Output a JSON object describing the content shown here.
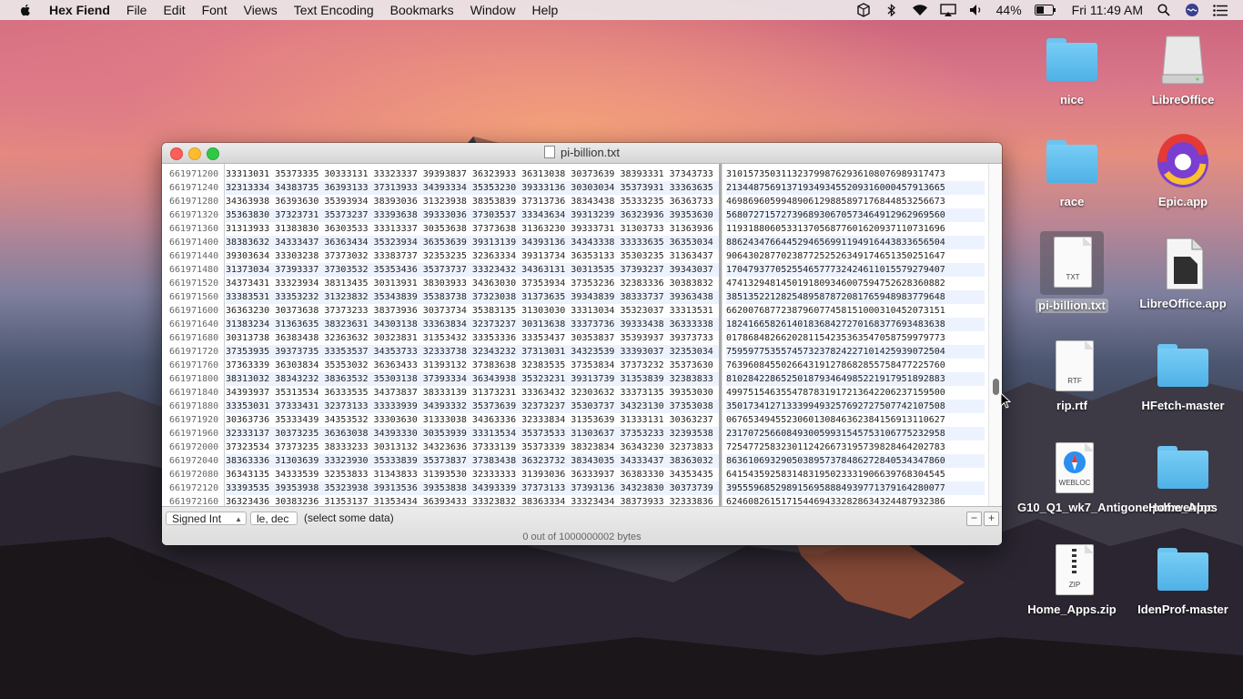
{
  "menubar": {
    "app_name": "Hex Fiend",
    "items": [
      "File",
      "Edit",
      "Font",
      "Views",
      "Text Encoding",
      "Bookmarks",
      "Window",
      "Help"
    ],
    "battery": "44%",
    "clock": "Fri 11:49 AM"
  },
  "window": {
    "title": "pi-billion.txt",
    "rows": [
      {
        "offset": "661971200",
        "hex": "33313031 35373335 30333131 33323337 39393837 36323933 36313038 30373639 38393331 37343733",
        "ascii": "3101573503113237998762936108076989317473"
      },
      {
        "offset": "661971240",
        "hex": "32313334 34383735 36393133 37313933 34393334 35353230 39333136 30303034 35373931 33363635",
        "ascii": "2134487569137193493455209316000457913665"
      },
      {
        "offset": "661971280",
        "hex": "34363938 36393630 35393934 38393036 31323938 38353839 37313736 38343438 35333235 36363733",
        "ascii": "4698696059948906129885897176844853256673"
      },
      {
        "offset": "661971320",
        "hex": "35363830 37323731 35373237 33393638 39333036 37303537 33343634 39313239 36323936 39353630",
        "ascii": "5680727157273968930670573464912962969560"
      },
      {
        "offset": "661971360",
        "hex": "31313933 31383830 36303533 33313337 30353638 37373638 31363230 39333731 31303733 31363936",
        "ascii": "1193188060533137056877601620937110731696"
      },
      {
        "offset": "661971400",
        "hex": "38383632 34333437 36363434 35323934 36353639 39313139 34393136 34343338 33333635 36353034",
        "ascii": "8862434766445294656991194916443833656504"
      },
      {
        "offset": "661971440",
        "hex": "39303634 33303238 37373032 33383737 32353235 32363334 39313734 36353133 35303235 31363437",
        "ascii": "9064302877023877252526349174651350251647"
      },
      {
        "offset": "661971480",
        "hex": "31373034 37393337 37303532 35353436 35373737 33323432 34363131 30313535 37393237 39343037",
        "ascii": "1704793770525546577732424611015579279407"
      },
      {
        "offset": "661971520",
        "hex": "34373431 33323934 38313435 30313931 38303933 34363030 37353934 37353236 32383336 30383832",
        "ascii": "4741329481450191809346007594752628360882"
      },
      {
        "offset": "661971560",
        "hex": "33383531 33353232 31323832 35343839 35383738 37323038 31373635 39343839 38333737 39363438",
        "ascii": "3851352212825489587872081765948983779648"
      },
      {
        "offset": "661971600",
        "hex": "36363230 30373638 37373233 38373936 30373734 35383135 31303030 33313034 35323037 33313531",
        "ascii": "6620076877238796077458151000310452073151"
      },
      {
        "offset": "661971640",
        "hex": "31383234 31363635 38323631 34303138 33363834 32373237 30313638 33373736 39333438 36333338",
        "ascii": "1824166582614018368427270168377693483638"
      },
      {
        "offset": "661971680",
        "hex": "30313738 36383438 32363632 30323831 31353432 33353336 33353437 30353837 35393937 39373733",
        "ascii": "0178684826620281154235363547058759979773"
      },
      {
        "offset": "661971720",
        "hex": "37353935 39373735 33353537 34353733 32333738 32343232 37313031 34323539 33393037 32353034",
        "ascii": "7595977535574573237824227101425939072504"
      },
      {
        "offset": "661971760",
        "hex": "37363339 36303834 35353032 36363433 31393132 37383638 32383535 37353834 37373232 35373630",
        "ascii": "7639608455026643191278682855758477225760"
      },
      {
        "offset": "661971800",
        "hex": "38313032 38343232 38363532 35303138 37393334 36343938 35323231 39313739 31353839 32383833",
        "ascii": "8102842286525018793464985221917951892883"
      },
      {
        "offset": "661971840",
        "hex": "34393937 35313534 36333535 34373837 38333139 31373231 33363432 32303632 33373135 39353030",
        "ascii": "4997515463554787831917213642206237159500"
      },
      {
        "offset": "661971880",
        "hex": "33353031 37333431 32373133 33333939 34393332 35373639 32373237 35303737 34323130 37353038",
        "ascii": "3501734127133399493257692727507742107508"
      },
      {
        "offset": "661971920",
        "hex": "30363736 35333439 34353532 33303630 31333038 34363336 32333834 31353639 31333131 30363237",
        "ascii": "0676534945523060130846362384156913110627"
      },
      {
        "offset": "661971960",
        "hex": "32333137 30373235 36363038 34393330 30353939 33313534 35373533 31303637 37353233 32393538",
        "ascii": "2317072566084930059931545753106775232958"
      },
      {
        "offset": "661972000",
        "hex": "37323534 37373235 38333233 30313132 34323636 37333139 35373339 38323834 36343230 32373833",
        "ascii": "7254772583230112426673195739828464202783"
      },
      {
        "offset": "661972040",
        "hex": "38363336 31303639 33323930 35333839 35373837 37383438 36323732 38343035 34333437 38363032",
        "ascii": "8636106932905038957378486272840534347860"
      },
      {
        "offset": "661972080",
        "hex": "36343135 34333539 32353833 31343833 31393530 32333333 31393036 36333937 36383330 34353435",
        "ascii": "6415435925831483195023331906639768304545"
      },
      {
        "offset": "661972120",
        "hex": "33393535 39353938 35323938 39313536 39353838 34393339 37373133 37393136 34323830 30373739",
        "ascii": "3955596852989156958884939771379164280077"
      },
      {
        "offset": "661972160",
        "hex": "36323436 30383236 31353137 31353434 36393433 33323832 38363334 33323434 38373933 32333836",
        "ascii": "6246082615171544694332828634324487932386"
      }
    ],
    "bottom": {
      "type_popup": "Signed Int",
      "endian_popup": "le, dec",
      "selection_message": "(select some data)",
      "minus": "−",
      "plus": "+",
      "status": "0 out of 1000000002 bytes"
    }
  },
  "desktop_icons": [
    {
      "label": "nice",
      "kind": "folder"
    },
    {
      "label": "LibreOffice",
      "kind": "drive"
    },
    {
      "label": "race",
      "kind": "folder"
    },
    {
      "label": "Epic.app",
      "kind": "app"
    },
    {
      "label": "pi-billion.txt",
      "kind": "txt",
      "tag": "TXT"
    },
    {
      "label": "LibreOffice.app",
      "kind": "app"
    },
    {
      "label": "rip.rtf",
      "kind": "rtf",
      "tag": "RTF"
    },
    {
      "label": "HFetch-master",
      "kind": "folder"
    },
    {
      "label": "G10_Q1_wk7_Antigone.pdf.webloc",
      "kind": "webloc",
      "tag": "WEBLOC"
    },
    {
      "label": "Home_Apps",
      "kind": "folder"
    },
    {
      "label": "Home_Apps.zip",
      "kind": "zip",
      "tag": "ZIP"
    },
    {
      "label": "IdenProf-master",
      "kind": "folder"
    }
  ]
}
